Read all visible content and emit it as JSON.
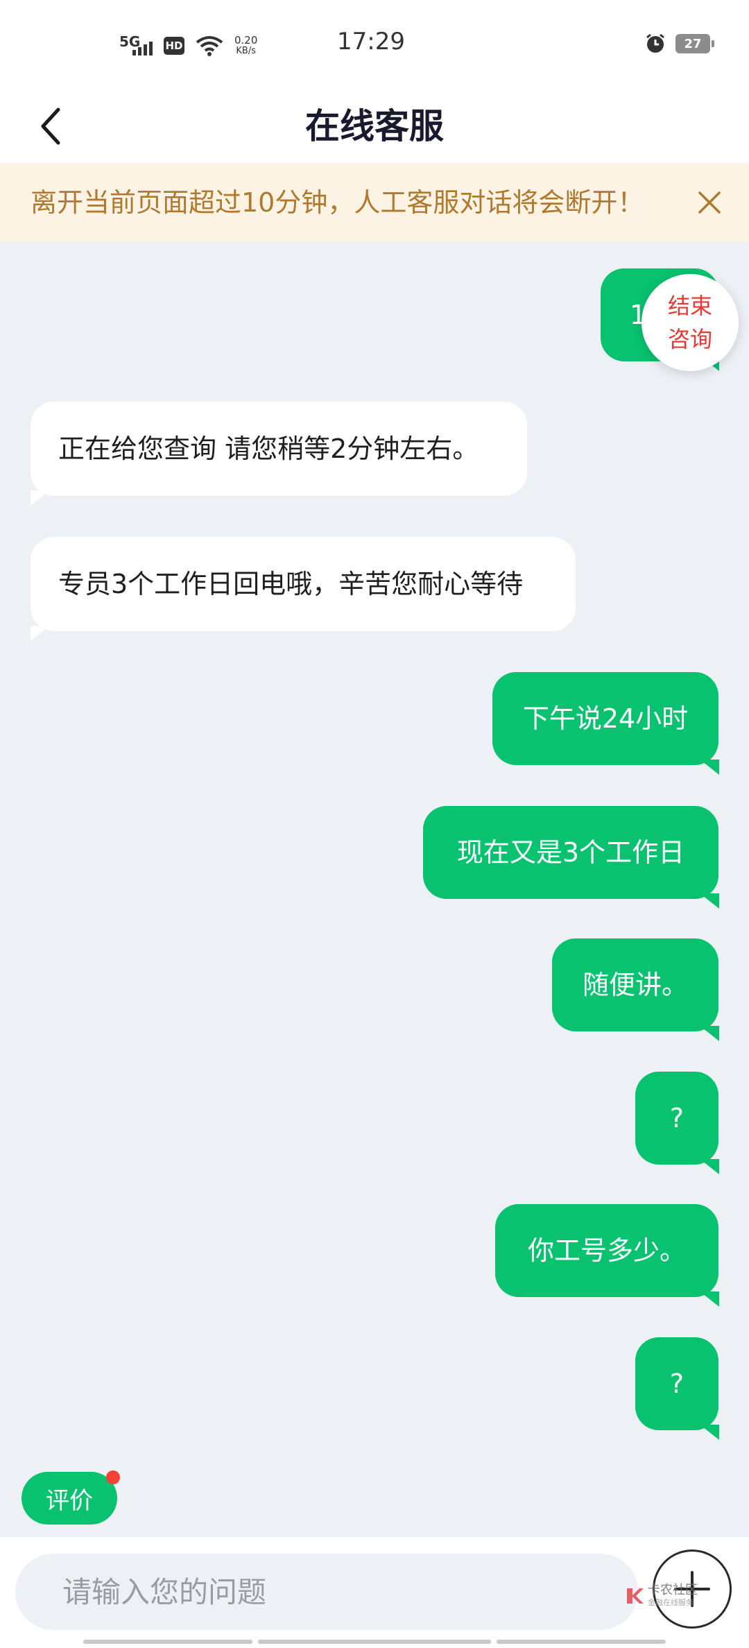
{
  "status_bar": {
    "network": "5G",
    "hd": "HD",
    "speed_value": "0.20",
    "speed_unit": "KB/s",
    "time": "17:29",
    "battery": "27"
  },
  "header": {
    "title": "在线客服"
  },
  "notice": {
    "text": "离开当前页面超过10分钟，人工客服对话将会断开！"
  },
  "end_consult": {
    "line1": "结束",
    "line2": "咨询"
  },
  "messages": [
    {
      "from": "user",
      "text": "1"
    },
    {
      "from": "agent",
      "text": "正在给您查询 请您稍等2分钟左右。"
    },
    {
      "from": "agent",
      "text": "专员3个工作日回电哦，辛苦您耐心等待"
    },
    {
      "from": "user",
      "text": "下午说24小时"
    },
    {
      "from": "user",
      "text": "现在又是3个工作日"
    },
    {
      "from": "user",
      "text": "随便讲。"
    },
    {
      "from": "user",
      "text": "?"
    },
    {
      "from": "user",
      "text": "你工号多少。"
    },
    {
      "from": "user",
      "text": "?"
    }
  ],
  "rate_button": {
    "label": "评价"
  },
  "input": {
    "placeholder": "请输入您的问题"
  },
  "watermark": {
    "text": "卡农社区",
    "sub": "金融在线服务"
  },
  "colors": {
    "accent": "#08c26f",
    "notice_bg": "#fdf3e5",
    "notice_text": "#b07a2e",
    "end_text": "#e53935"
  }
}
